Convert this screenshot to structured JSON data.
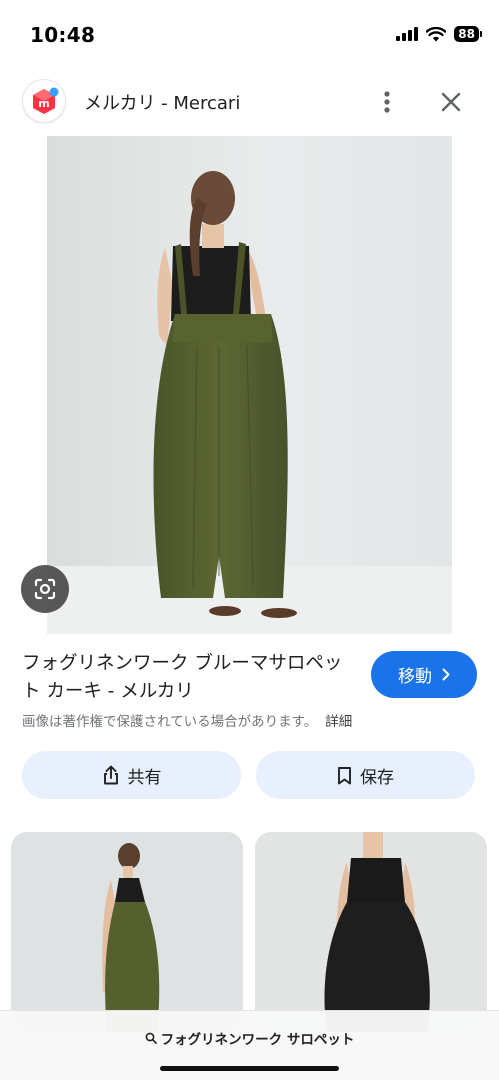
{
  "status_bar": {
    "time": "10:48",
    "battery": "88"
  },
  "header": {
    "site_name": "メルカリ - Mercari",
    "logo_letter": "m"
  },
  "result": {
    "title": "フォグリネンワーク ブルーマサロペット カーキ - メルカリ",
    "visit_label": "移動",
    "copyright_note": "画像は著作権で保護されている場合があります。",
    "detail_link": "詳細"
  },
  "actions": {
    "share_label": "共有",
    "save_label": "保存"
  },
  "bottom": {
    "search_query": "フォグリネンワーク サロペット"
  },
  "colors": {
    "accent": "#1a73e8",
    "action_bg": "#e8f0fe",
    "khaki": "#56602e",
    "mercari_red": "#ff333f"
  },
  "icons": [
    "signal-icon",
    "wifi-icon",
    "battery-icon",
    "mercari-logo-icon",
    "more-vert-icon",
    "close-icon",
    "google-lens-icon",
    "chevron-right-icon",
    "share-icon",
    "bookmark-icon",
    "search-icon"
  ]
}
